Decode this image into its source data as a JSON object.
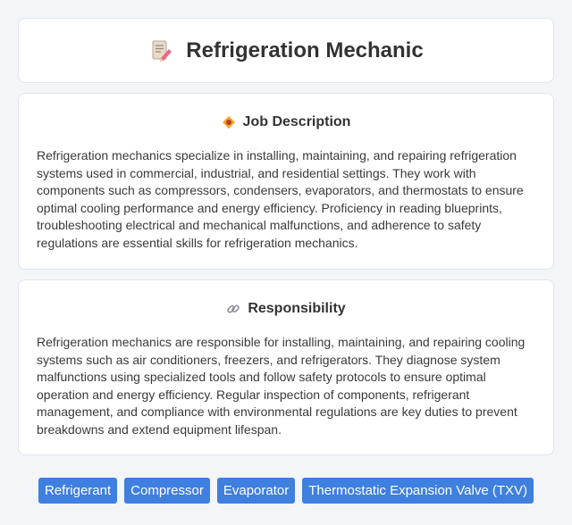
{
  "header": {
    "title": "Refrigeration Mechanic",
    "icon": "document-pencil-icon"
  },
  "job_description": {
    "heading": "Job Description",
    "icon": "diamond-badge-icon",
    "text": "Refrigeration mechanics specialize in installing, maintaining, and repairing refrigeration systems used in commercial, industrial, and residential settings. They work with components such as compressors, condensers, evaporators, and thermostats to ensure optimal cooling performance and energy efficiency. Proficiency in reading blueprints, troubleshooting electrical and mechanical malfunctions, and adherence to safety regulations are essential skills for refrigeration mechanics."
  },
  "responsibility": {
    "heading": "Responsibility",
    "icon": "link-icon",
    "text": "Refrigeration mechanics are responsible for installing, maintaining, and repairing cooling systems such as air conditioners, freezers, and refrigerators. They diagnose system malfunctions using specialized tools and follow safety protocols to ensure optimal operation and energy efficiency. Regular inspection of components, refrigerant management, and compliance with environmental regulations are key duties to prevent breakdowns and extend equipment lifespan."
  },
  "tags": [
    "Refrigerant",
    "Compressor",
    "Evaporator",
    "Thermostatic Expansion Valve (TXV)"
  ],
  "colors": {
    "tag_background": "#3f7fe0",
    "page_background": "#f3f5f9"
  }
}
